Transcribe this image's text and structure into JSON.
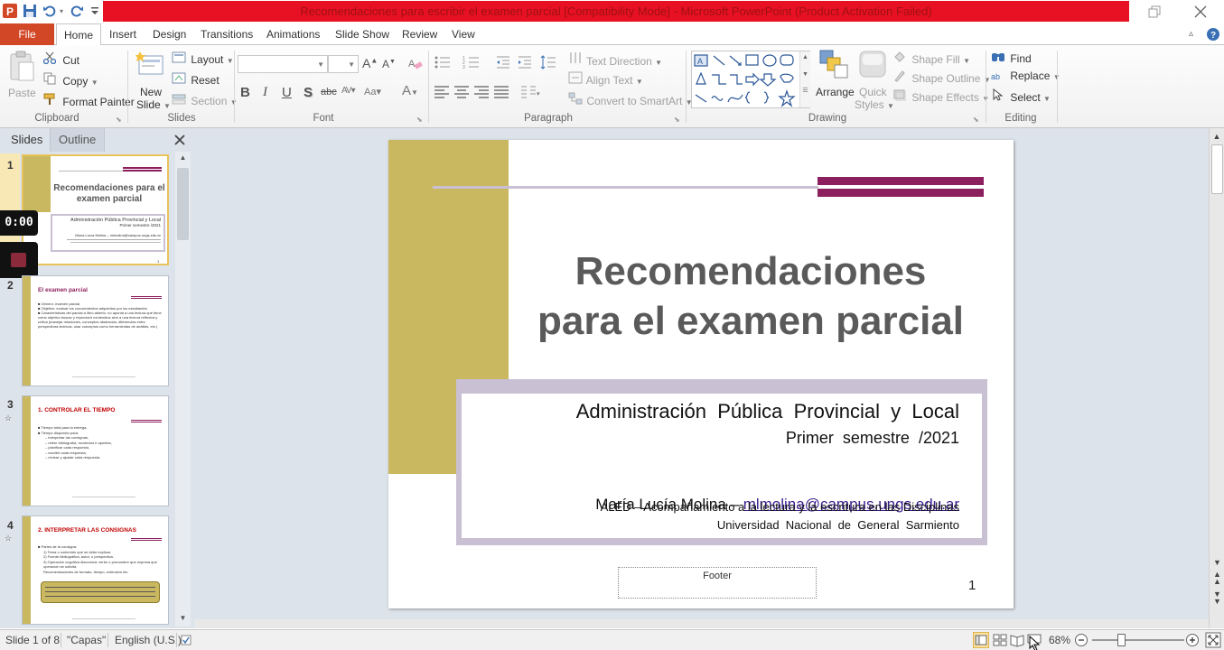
{
  "window": {
    "title": "Recomendaciones para escribir el examen parcial [Compatibility Mode] - Microsoft PowerPoint (Product Activation Failed)",
    "app_icon": "powerpoint-icon"
  },
  "tabs": [
    "File",
    "Home",
    "Insert",
    "Design",
    "Transitions",
    "Animations",
    "Slide Show",
    "Review",
    "View"
  ],
  "ribbon": {
    "clipboard": {
      "label": "Clipboard",
      "paste": "Paste",
      "cut": "Cut",
      "copy": "Copy",
      "format_painter": "Format Painter"
    },
    "slides": {
      "label": "Slides",
      "new_slide_1": "New",
      "new_slide_2": "Slide",
      "layout": "Layout",
      "reset": "Reset",
      "section": "Section"
    },
    "font": {
      "label": "Font",
      "bold": "B",
      "italic": "I",
      "underline": "U",
      "shadow": "S",
      "strike": "abc"
    },
    "paragraph": {
      "label": "Paragraph",
      "text_direction": "Text Direction",
      "align_text": "Align Text",
      "convert_smartart": "Convert to SmartArt"
    },
    "drawing": {
      "label": "Drawing",
      "arrange": "Arrange",
      "quick_styles_1": "Quick",
      "quick_styles_2": "Styles",
      "shape_fill": "Shape Fill",
      "shape_outline": "Shape Outline",
      "shape_effects": "Shape Effects"
    },
    "editing": {
      "label": "Editing",
      "find": "Find",
      "replace": "Replace",
      "select": "Select"
    }
  },
  "pane": {
    "tab_slides": "Slides",
    "tab_outline": "Outline",
    "timer": "0:00",
    "thumbnails": [
      {
        "num": "1",
        "title": "Recomendaciones para el examen parcial",
        "sub1": "Administración Pública Provincial y Local",
        "sub2": "Primer semestre /2021",
        "author": "María Lucía Molina – mlmolina@campus.ungs.edu.ar"
      },
      {
        "num": "2",
        "title": "El examen parcial",
        "b1": "Género: examen parcial",
        "b2": "Objetivo: evaluar los conocimientos adquiridos por los estudiantes",
        "b3": "Características del parcial a libro abierto: no apunta a una lectura que tiene como objetivo buscar y reproducir contenidos sino a una lectura reflexiva y crítica (manejar relaciones, conceptos abstractos, diferencias entre perspectivas teóricas, usar conceptos como herramientas de análisis, etc.)"
      },
      {
        "num": "3",
        "title": "1. CONTROLAR EL TIEMPO",
        "b1": "Tiempo total para la entrega.",
        "b2": "Tiempo dispuesto para:",
        "s1": "interpretar las consignas,",
        "s2": "releer bibliografía, recolectar e apuntes,",
        "s3": "planificar cada respuesta,",
        "s4": "escribir cada respuesta,",
        "s5": "revisar y ajustar cada respuesta."
      },
      {
        "num": "4",
        "title": "2. INTERPRETAR LAS CONSIGNAS",
        "b1": "Partes de la consigna:",
        "s1": "1) Tema o contenido que se debe explicar.",
        "s2": "2) Fuente bibliográfica, autor, o perspectiva.",
        "s3": "3) Operación cognitiva discursiva: verbo o pronombre que expresa qué operación se solicita.",
        "s4": "Recomendaciones de formato, tiempo, extensión etc."
      }
    ]
  },
  "slide": {
    "title_line1": "Recomendaciones",
    "title_line2": "para el examen parcial",
    "course": "Administración  Pública  Provincial  y  Local",
    "semester": "Primer  semestre  /2021",
    "author_prefix": "María Lucía Molina – ",
    "author_email": "mlmolina@campus.ungs.edu.ar",
    "program": "ALED – Acompañamiento a la lectura y la escritura en las Disciplinas",
    "university": "Universidad  Nacional  de  General  Sarmiento",
    "footer": "Footer",
    "page_number": "1"
  },
  "status": {
    "slide_info": "Slide 1 of 8",
    "theme": "\"Capas\"",
    "language": "English (U.S.)",
    "zoom": "68%"
  },
  "colors": {
    "accent_red": "#e81123",
    "file_tab": "#d24726",
    "slide_gold": "#c9b860",
    "slide_maroon": "#8c1f5e",
    "slide_lilac": "#c9c0d3"
  }
}
